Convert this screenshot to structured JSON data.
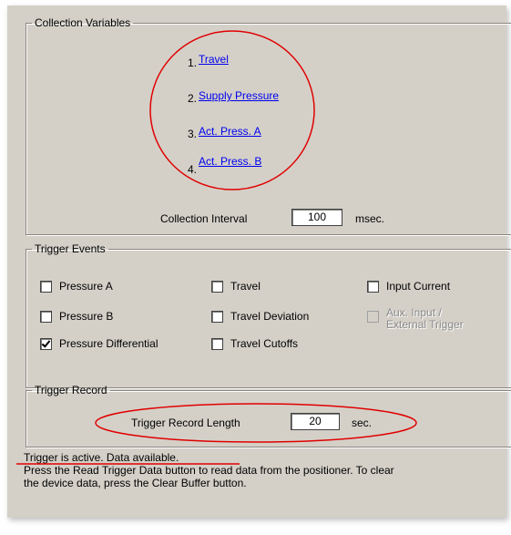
{
  "collection_variables": {
    "title": "Collection Variables",
    "items": [
      {
        "num": "1.",
        "label": "Travel"
      },
      {
        "num": "2.",
        "label": "Supply Pressure"
      },
      {
        "num": "3.",
        "label": "Act. Press. A"
      },
      {
        "num": "4.",
        "label": "Act. Press. B"
      }
    ],
    "interval_label": "Collection Interval",
    "interval_value": "100",
    "interval_unit": "msec."
  },
  "trigger_events": {
    "title": "Trigger Events",
    "pressure_a": {
      "label": "Pressure A",
      "checked": false
    },
    "pressure_b": {
      "label": "Pressure B",
      "checked": false
    },
    "pressure_diff": {
      "label": "Pressure Differential",
      "checked": true
    },
    "travel": {
      "label": "Travel",
      "checked": false
    },
    "travel_deviation": {
      "label": "Travel Deviation",
      "checked": false
    },
    "travel_cutoffs": {
      "label": "Travel Cutoffs",
      "checked": false
    },
    "input_current": {
      "label": "Input Current",
      "checked": false
    },
    "aux_line1": "Aux. Input /",
    "aux_line2": "External Trigger"
  },
  "trigger_record": {
    "title": "Trigger Record",
    "length_label": "Trigger Record Length",
    "length_value": "20",
    "length_unit": "sec."
  },
  "status": {
    "line1": "Trigger is active.  Data available.",
    "line2": "Press the Read Trigger Data button to read data from the positioner.  To clear",
    "line3": "the device data, press the Clear Buffer button."
  },
  "colors": {
    "annotation": "#e00000",
    "link": "#0000ee",
    "panel": "#d4d0c8"
  },
  "icons": {
    "checkbox_checked": "checkmark-icon"
  }
}
